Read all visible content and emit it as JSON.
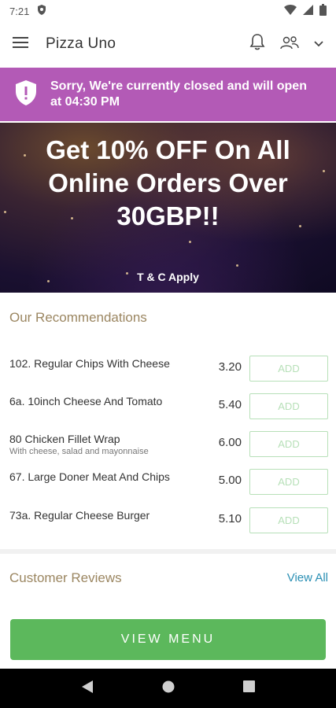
{
  "status_bar": {
    "time": "7:21"
  },
  "app_bar": {
    "title": "Pizza Uno"
  },
  "closed_banner": {
    "message": "Sorry, We're currently closed and will open at 04:30 PM"
  },
  "promo": {
    "headline": "Get 10% OFF On All Online Orders Over 30GBP!!",
    "terms": "T & C Apply"
  },
  "recommendations": {
    "title": "Our Recommendations",
    "add_label": "ADD",
    "items": [
      {
        "name": "102. Regular Chips With Cheese",
        "description": "",
        "price": "3.20"
      },
      {
        "name": "6a. 10inch Cheese And Tomato",
        "description": "",
        "price": "5.40"
      },
      {
        "name": "80 Chicken Fillet Wrap",
        "description": "With cheese, salad and mayonnaise",
        "price": "6.00"
      },
      {
        "name": "67. Large Doner Meat And Chips",
        "description": "",
        "price": "5.00"
      },
      {
        "name": "73a. Regular Cheese Burger",
        "description": "",
        "price": "5.10"
      }
    ]
  },
  "reviews": {
    "title": "Customer Reviews",
    "view_all": "View All"
  },
  "footer": {
    "view_menu": "VIEW MENU"
  },
  "colors": {
    "banner": "#b35ab6",
    "accent_green": "#5cb85c",
    "section_title": "#9b8661",
    "link": "#2a8fb4"
  },
  "icons": [
    "menu-icon",
    "bell-icon",
    "users-icon",
    "chevron-down-icon",
    "shield-alert-icon",
    "back-icon",
    "home-icon",
    "recents-icon"
  ]
}
